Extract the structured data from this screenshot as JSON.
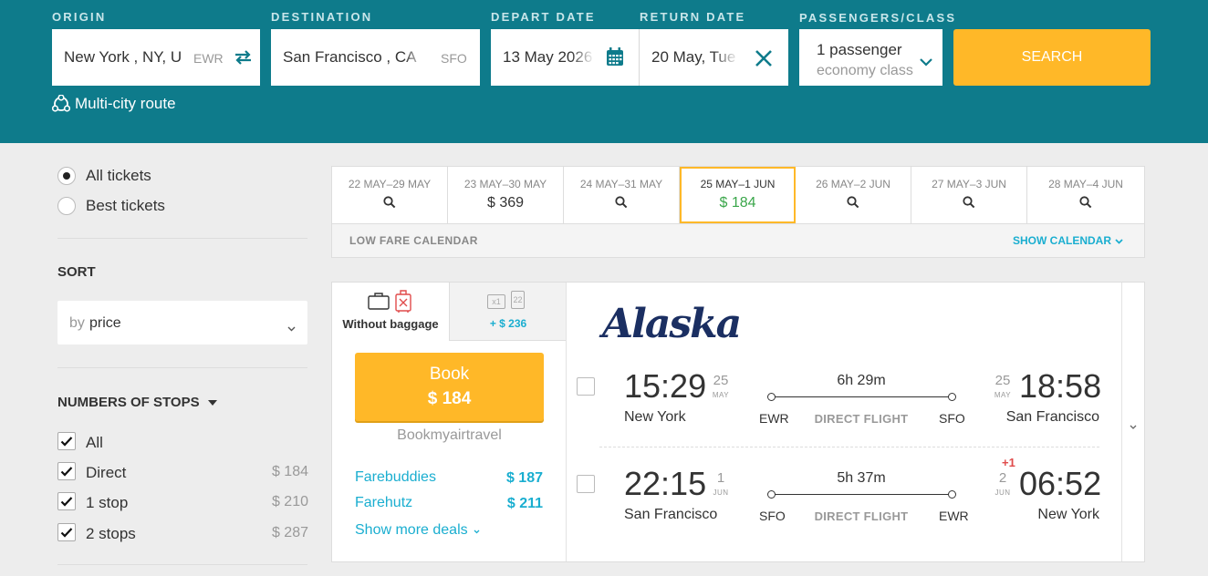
{
  "search": {
    "origin": {
      "label": "ORIGIN",
      "value": "New York , NY, U",
      "code": "EWR"
    },
    "destination": {
      "label": "DESTINATION",
      "value": "San Francisco , CA",
      "code": "SFO"
    },
    "depart": {
      "label": "DEPART DATE",
      "value": "13 May 2026"
    },
    "return": {
      "label": "RETURN DATE",
      "value": "20 May, Tue"
    },
    "passengers": {
      "label": "PASSENGERS/CLASS",
      "count": "1 passenger",
      "class": "economy class"
    },
    "search_label": "SEARCH",
    "multicity_label": "Multi-city route"
  },
  "filters": {
    "ticket_types": [
      {
        "label": "All tickets",
        "selected": true
      },
      {
        "label": "Best tickets",
        "selected": false
      }
    ],
    "sort": {
      "heading": "SORT",
      "prefix": "by",
      "value": "price"
    },
    "stops": {
      "heading": "NUMBERS OF STOPS",
      "items": [
        {
          "label": "All",
          "price": ""
        },
        {
          "label": "Direct",
          "price": "$ 184"
        },
        {
          "label": "1 stop",
          "price": "$ 210"
        },
        {
          "label": "2 stops",
          "price": "$ 287"
        }
      ]
    }
  },
  "calendar": {
    "cells": [
      {
        "range": "22 MAY–29 MAY",
        "price": ""
      },
      {
        "range": "23 MAY–30 MAY",
        "price": "$ 369"
      },
      {
        "range": "24 MAY–31 MAY",
        "price": ""
      },
      {
        "range": "25 MAY–1 JUN",
        "price": "$ 184"
      },
      {
        "range": "26 MAY–2 JUN",
        "price": ""
      },
      {
        "range": "27 MAY–3 JUN",
        "price": ""
      },
      {
        "range": "28 MAY–4 JUN",
        "price": ""
      }
    ],
    "footer_label": "LOW FARE CALENDAR",
    "show_label": "SHOW CALENDAR"
  },
  "result": {
    "baggage_tabs": {
      "without": "Without baggage",
      "with_price": "+ $ 236",
      "with_badges": [
        "x1",
        "22"
      ]
    },
    "book": {
      "label": "Book",
      "price": "$ 184"
    },
    "provider": "Bookmyairtravel",
    "deals": [
      {
        "name": "Farebuddies",
        "price": "$ 187"
      },
      {
        "name": "Farehutz",
        "price": "$ 211"
      }
    ],
    "more_deals": "Show more deals",
    "airline": "Alaska",
    "outbound": {
      "dep_time": "15:29",
      "dep_day": "25",
      "dep_month": "MAY",
      "dep_city": "New York",
      "dep_code": "EWR",
      "duration": "6h 29m",
      "type": "DIRECT FLIGHT",
      "arr_time": "18:58",
      "arr_day": "25",
      "arr_month": "MAY",
      "arr_city": "San Francisco",
      "arr_code": "SFO"
    },
    "inbound": {
      "dep_time": "22:15",
      "dep_day": "1",
      "dep_month": "JUN",
      "dep_city": "San Francisco",
      "dep_code": "SFO",
      "duration": "5h 37m",
      "type": "DIRECT FLIGHT",
      "plus_day": "+1",
      "arr_time": "06:52",
      "arr_day": "2",
      "arr_month": "JUN",
      "arr_city": "New York",
      "arr_code": "EWR"
    }
  },
  "colors": {
    "header": "#0e7b8b",
    "accent": "#ffb828",
    "link": "#1aaed0",
    "green": "#3aa64a"
  }
}
